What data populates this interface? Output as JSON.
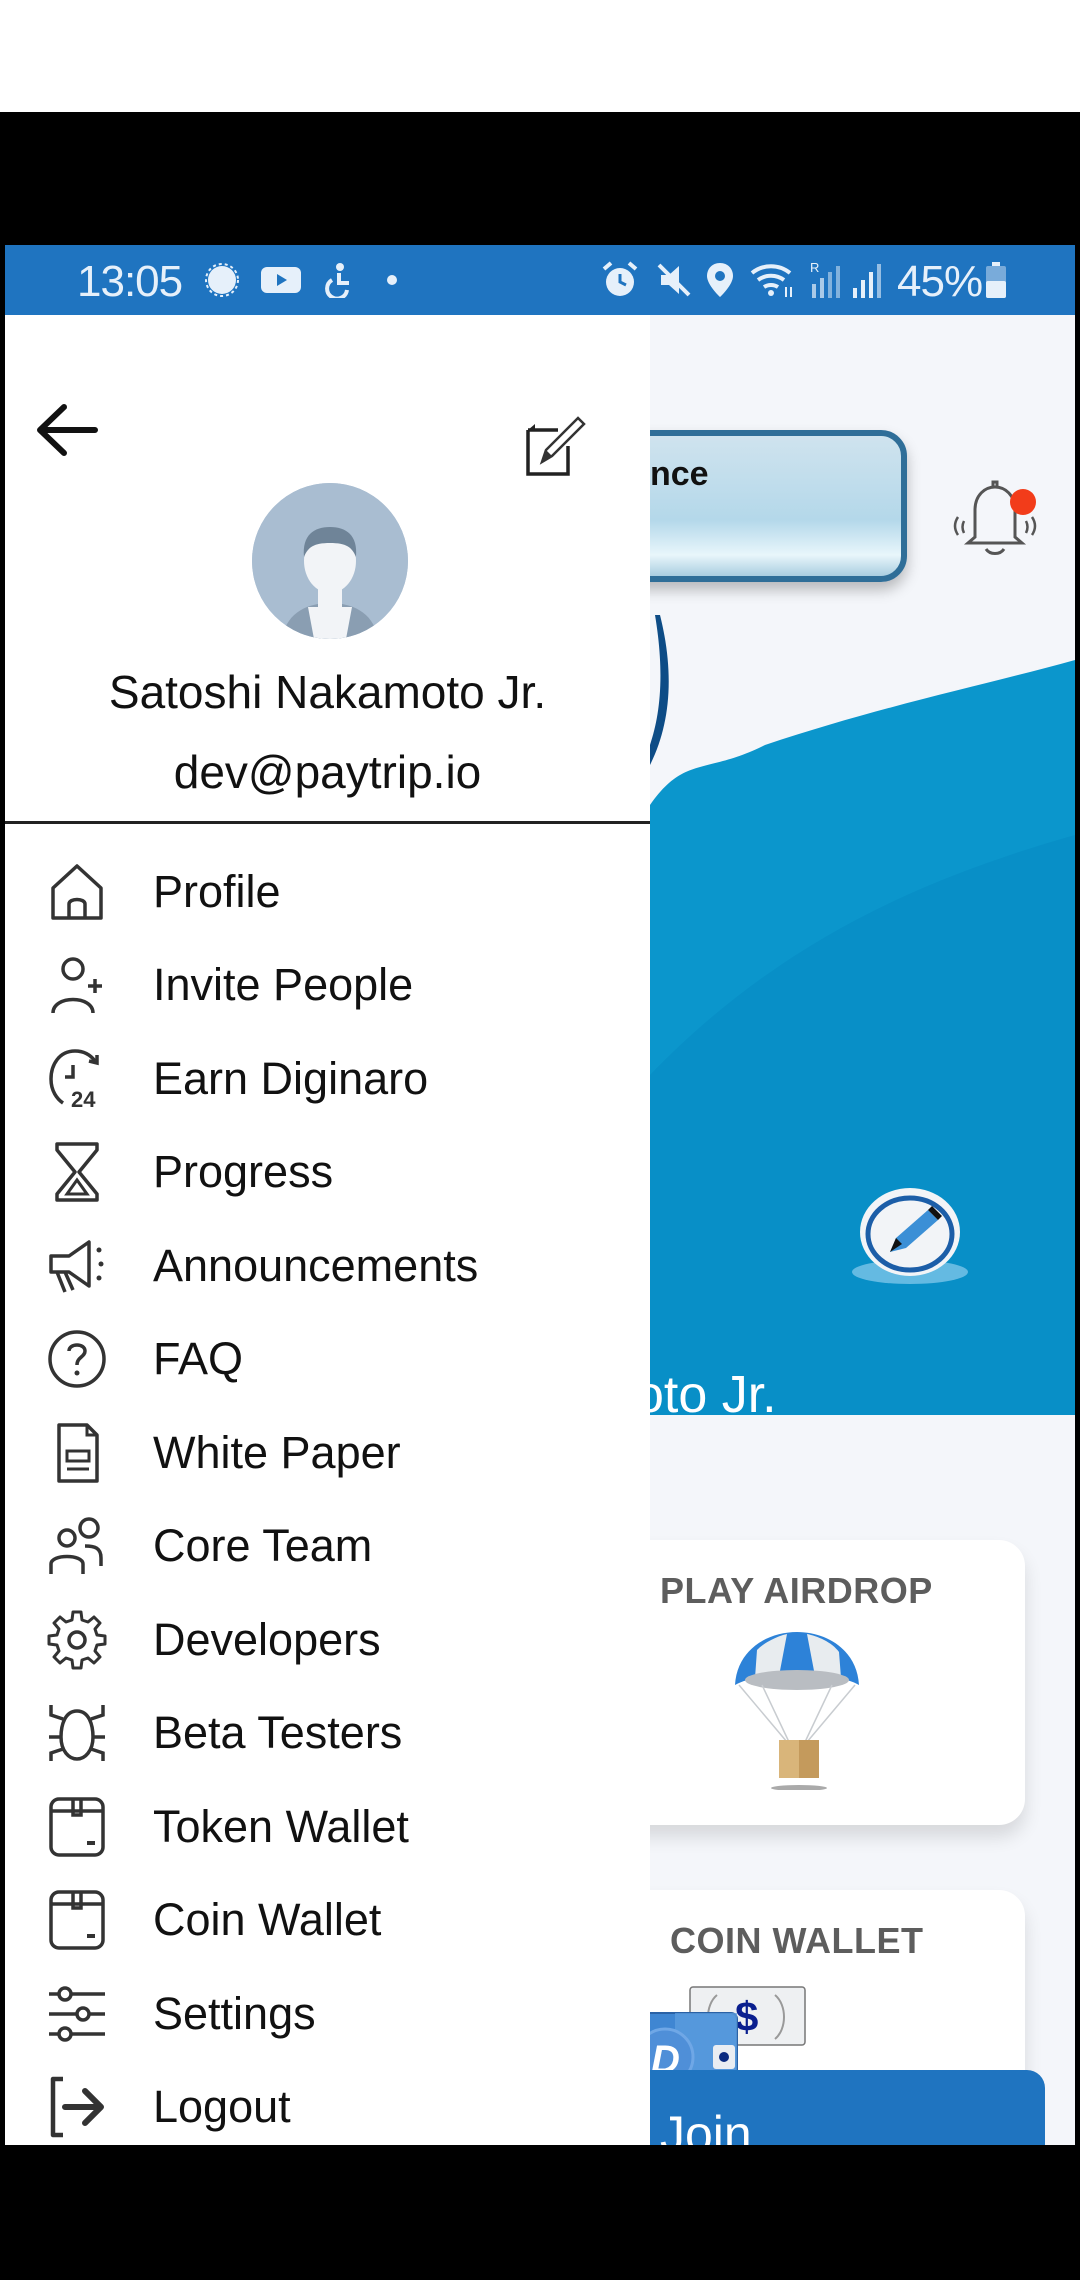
{
  "status_bar": {
    "time": "13:05",
    "battery": "45%",
    "left_icons": [
      "signal-messenger-icon",
      "youtube-icon",
      "accessibility-icon",
      "dot-icon"
    ],
    "right_icons": [
      "alarm-icon",
      "mute-icon",
      "location-icon",
      "wifi-icon",
      "roaming-signal-icon",
      "signal-icon",
      "battery-icon"
    ]
  },
  "drawer": {
    "user": {
      "name": "Satoshi Nakamoto Jr.",
      "email": "dev@paytrip.io"
    },
    "menu": [
      {
        "label": "Profile",
        "icon": "home-icon"
      },
      {
        "label": "Invite People",
        "icon": "add-user-icon"
      },
      {
        "label": "Earn Diginaro",
        "icon": "clock-24-icon"
      },
      {
        "label": "Progress",
        "icon": "hourglass-icon"
      },
      {
        "label": "Announcements",
        "icon": "megaphone-icon"
      },
      {
        "label": "FAQ",
        "icon": "question-circle-icon"
      },
      {
        "label": "White Paper",
        "icon": "document-icon"
      },
      {
        "label": "Core Team",
        "icon": "team-icon"
      },
      {
        "label": "Developers",
        "icon": "gear-icon"
      },
      {
        "label": "Beta Testers",
        "icon": "bug-icon"
      },
      {
        "label": "Token Wallet",
        "icon": "wallet-box-icon"
      },
      {
        "label": "Coin Wallet",
        "icon": "wallet-box-icon"
      },
      {
        "label": "Settings",
        "icon": "sliders-icon"
      },
      {
        "label": "Logout",
        "icon": "logout-icon"
      }
    ]
  },
  "background_app": {
    "balance_label_partial": "nce",
    "name_partial": "oto Jr.",
    "cards": [
      {
        "title": "PLAY AIRDROP",
        "icon": "parachute-icon"
      },
      {
        "title": "COIN WALLET",
        "icon": "coin-wallet-icon"
      }
    ],
    "join_button_partial": "Join",
    "notification_badge_color": "#f23c1a"
  },
  "colors": {
    "status_bar": "#1f74c0",
    "accent_blue": "#1f74c0",
    "wave_blue": "#0b96cc"
  }
}
